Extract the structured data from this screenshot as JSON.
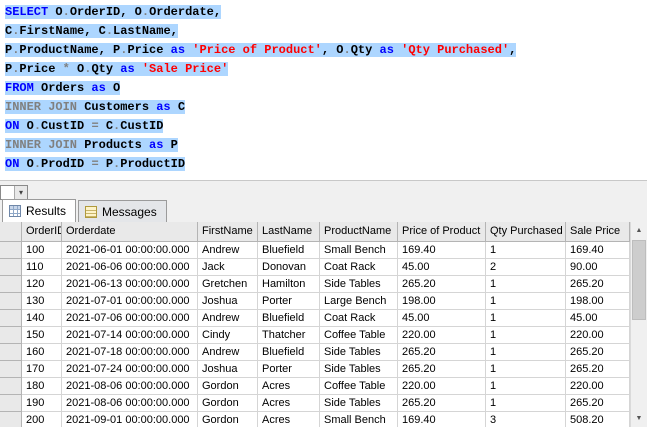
{
  "colors": {
    "kw": "#0000ff",
    "idc": "#000000",
    "str": "#ff0000",
    "op": "#808080",
    "sel": "#add6ff",
    "hdrbg": "#e9e9e9",
    "hdrbd": "#b4b4b4",
    "cellbd": "#d5d5d5"
  },
  "editor": {
    "lines": [
      [
        {
          "t": "SELECT",
          "c": "kw"
        },
        {
          "t": " O",
          "c": "id"
        },
        {
          "t": ".",
          "c": "op"
        },
        {
          "t": "OrderID",
          "c": "id"
        },
        {
          "t": ", O",
          "c": "id"
        },
        {
          "t": ".",
          "c": "op"
        },
        {
          "t": "Orderdate",
          "c": "id"
        },
        {
          "t": ",",
          "c": "id"
        }
      ],
      [
        {
          "t": "C",
          "c": "id"
        },
        {
          "t": ".",
          "c": "op"
        },
        {
          "t": "FirstName",
          "c": "id"
        },
        {
          "t": ", C",
          "c": "id"
        },
        {
          "t": ".",
          "c": "op"
        },
        {
          "t": "LastName",
          "c": "id"
        },
        {
          "t": ",",
          "c": "id"
        }
      ],
      [
        {
          "t": "P",
          "c": "id"
        },
        {
          "t": ".",
          "c": "op"
        },
        {
          "t": "ProductName",
          "c": "id"
        },
        {
          "t": ", P",
          "c": "id"
        },
        {
          "t": ".",
          "c": "op"
        },
        {
          "t": "Price ",
          "c": "id"
        },
        {
          "t": "as",
          "c": "kw"
        },
        {
          "t": " ",
          "c": "id"
        },
        {
          "t": "'Price of Product'",
          "c": "str"
        },
        {
          "t": ", O",
          "c": "id"
        },
        {
          "t": ".",
          "c": "op"
        },
        {
          "t": "Qty ",
          "c": "id"
        },
        {
          "t": "as",
          "c": "kw"
        },
        {
          "t": " ",
          "c": "id"
        },
        {
          "t": "'Qty Purchased'",
          "c": "str"
        },
        {
          "t": ",",
          "c": "id"
        }
      ],
      [
        {
          "t": "P",
          "c": "id"
        },
        {
          "t": ".",
          "c": "op"
        },
        {
          "t": "Price ",
          "c": "id"
        },
        {
          "t": "*",
          "c": "op"
        },
        {
          "t": " O",
          "c": "id"
        },
        {
          "t": ".",
          "c": "op"
        },
        {
          "t": "Qty ",
          "c": "id"
        },
        {
          "t": "as",
          "c": "kw"
        },
        {
          "t": " ",
          "c": "id"
        },
        {
          "t": "'Sale Price'",
          "c": "str"
        }
      ],
      [
        {
          "t": "FROM",
          "c": "kw"
        },
        {
          "t": " Orders ",
          "c": "id"
        },
        {
          "t": "as",
          "c": "kw"
        },
        {
          "t": " O",
          "c": "id"
        }
      ],
      [
        {
          "t": "INNER JOIN",
          "c": "op"
        },
        {
          "t": " Customers ",
          "c": "id"
        },
        {
          "t": "as",
          "c": "kw"
        },
        {
          "t": " C",
          "c": "id"
        }
      ],
      [
        {
          "t": "ON",
          "c": "kw"
        },
        {
          "t": " O",
          "c": "id"
        },
        {
          "t": ".",
          "c": "op"
        },
        {
          "t": "CustID ",
          "c": "id"
        },
        {
          "t": "=",
          "c": "op"
        },
        {
          "t": " C",
          "c": "id"
        },
        {
          "t": ".",
          "c": "op"
        },
        {
          "t": "CustID",
          "c": "id"
        }
      ],
      [
        {
          "t": "INNER JOIN",
          "c": "op"
        },
        {
          "t": " Products ",
          "c": "id"
        },
        {
          "t": "as",
          "c": "kw"
        },
        {
          "t": " P",
          "c": "id"
        }
      ],
      [
        {
          "t": "ON",
          "c": "kw"
        },
        {
          "t": " O",
          "c": "id"
        },
        {
          "t": ".",
          "c": "op"
        },
        {
          "t": "ProdID ",
          "c": "id"
        },
        {
          "t": "=",
          "c": "op"
        },
        {
          "t": " P",
          "c": "id"
        },
        {
          "t": ".",
          "c": "op"
        },
        {
          "t": "ProductID",
          "c": "id"
        }
      ]
    ]
  },
  "tabs": {
    "results_label": "Results",
    "messages_label": "Messages"
  },
  "grid": {
    "columns": [
      "OrderID",
      "Orderdate",
      "FirstName",
      "LastName",
      "ProductName",
      "Price of Product",
      "Qty Purchased",
      "Sale Price"
    ],
    "widths": [
      40,
      136,
      60,
      62,
      78,
      88,
      80,
      64
    ],
    "rows": [
      [
        "100",
        "2021-06-01 00:00:00.000",
        "Andrew",
        "Bluefield",
        "Small Bench",
        "169.40",
        "1",
        "169.40"
      ],
      [
        "110",
        "2021-06-06 00:00:00.000",
        "Jack",
        "Donovan",
        "Coat Rack",
        "45.00",
        "2",
        "90.00"
      ],
      [
        "120",
        "2021-06-13 00:00:00.000",
        "Gretchen",
        "Hamilton",
        "Side Tables",
        "265.20",
        "1",
        "265.20"
      ],
      [
        "130",
        "2021-07-01 00:00:00.000",
        "Joshua",
        "Porter",
        "Large Bench",
        "198.00",
        "1",
        "198.00"
      ],
      [
        "140",
        "2021-07-06 00:00:00.000",
        "Andrew",
        "Bluefield",
        "Coat Rack",
        "45.00",
        "1",
        "45.00"
      ],
      [
        "150",
        "2021-07-14 00:00:00.000",
        "Cindy",
        "Thatcher",
        "Coffee Table",
        "220.00",
        "1",
        "220.00"
      ],
      [
        "160",
        "2021-07-18 00:00:00.000",
        "Andrew",
        "Bluefield",
        "Side Tables",
        "265.20",
        "1",
        "265.20"
      ],
      [
        "170",
        "2021-07-24 00:00:00.000",
        "Joshua",
        "Porter",
        "Side Tables",
        "265.20",
        "1",
        "265.20"
      ],
      [
        "180",
        "2021-08-06 00:00:00.000",
        "Gordon",
        "Acres",
        "Coffee Table",
        "220.00",
        "1",
        "220.00"
      ],
      [
        "190",
        "2021-08-06 00:00:00.000",
        "Gordon",
        "Acres",
        "Side Tables",
        "265.20",
        "1",
        "265.20"
      ],
      [
        "200",
        "2021-09-01 00:00:00.000",
        "Gordon",
        "Acres",
        "Small Bench",
        "169.40",
        "3",
        "508.20"
      ]
    ]
  },
  "scrollbar": {
    "up_glyph": "▲",
    "down_glyph": "▼"
  },
  "combobox": {
    "arrow_glyph": "▾"
  }
}
